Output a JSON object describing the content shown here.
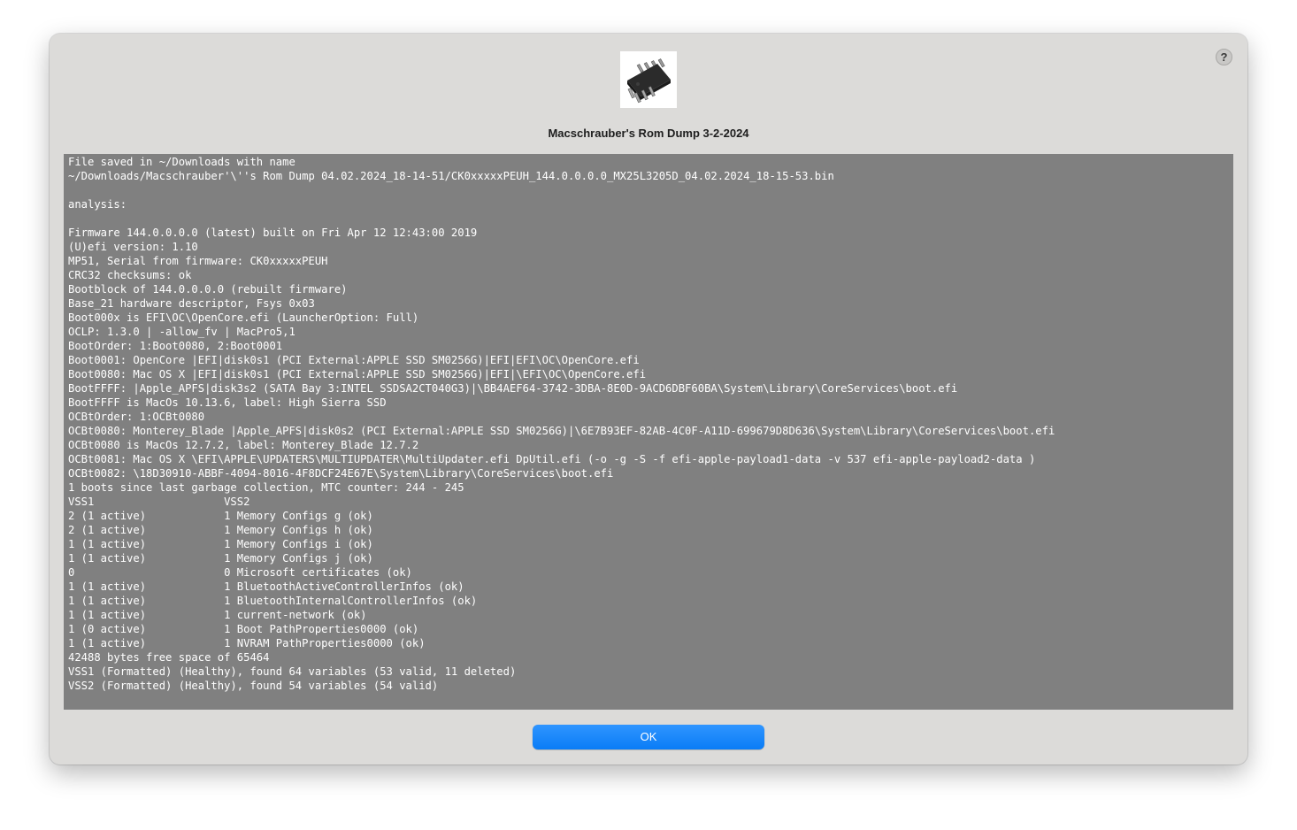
{
  "dialog": {
    "title": "Macschrauber's Rom Dump 3-2-2024",
    "help_label": "?",
    "ok_label": "OK",
    "icon": "chip-icon",
    "log_background": "#808080",
    "accent": "#0a7cf6"
  },
  "log": {
    "lines": [
      "File saved in ~/Downloads with name",
      "~/Downloads/Macschrauber'\\''s Rom Dump 04.02.2024_18-14-51/CK0xxxxxPEUH_144.0.0.0.0_MX25L3205D_04.02.2024_18-15-53.bin",
      "",
      "analysis:",
      "",
      "Firmware 144.0.0.0.0 (latest) built on Fri Apr 12 12:43:00 2019",
      "(U)efi version: 1.10",
      "MP51, Serial from firmware: CK0xxxxxPEUH",
      "CRC32 checksums: ok",
      "Bootblock of 144.0.0.0.0 (rebuilt firmware)",
      "Base_21 hardware descriptor, Fsys 0x03",
      "Boot000x is EFI\\OC\\OpenCore.efi (LauncherOption: Full)",
      "OCLP: 1.3.0 | -allow_fv | MacPro5,1",
      "BootOrder: 1:Boot0080, 2:Boot0001",
      "Boot0001: OpenCore |EFI|disk0s1 (PCI External:APPLE SSD SM0256G)|EFI|EFI\\OC\\OpenCore.efi",
      "Boot0080: Mac OS X |EFI|disk0s1 (PCI External:APPLE SSD SM0256G)|EFI|\\EFI\\OC\\OpenCore.efi",
      "BootFFFF: |Apple_APFS|disk3s2 (SATA Bay 3:INTEL SSDSA2CT040G3)|\\BB4AEF64-3742-3DBA-8E0D-9ACD6DBF60BA\\System\\Library\\CoreServices\\boot.efi",
      "BootFFFF is MacOs 10.13.6, label: High Sierra SSD",
      "OCBtOrder: 1:OCBt0080",
      "OCBt0080: Monterey_Blade |Apple_APFS|disk0s2 (PCI External:APPLE SSD SM0256G)|\\6E7B93EF-82AB-4C0F-A11D-699679D8D636\\System\\Library\\CoreServices\\boot.efi",
      "OCBt0080 is MacOs 12.7.2, label: Monterey_Blade 12.7.2",
      "OCBt0081: Mac OS X \\EFI\\APPLE\\UPDATERS\\MULTIUPDATER\\MultiUpdater.efi DpUtil.efi (-o -g -S -f efi-apple-payload1-data -v 537 efi-apple-payload2-data )",
      "OCBt0082: \\18D30910-ABBF-4094-8016-4F8DCF24E67E\\System\\Library\\CoreServices\\boot.efi",
      "1 boots since last garbage collection, MTC counter: 244 - 245",
      "VSS1                    VSS2",
      "2 (1 active)            1 Memory Configs g (ok)",
      "2 (1 active)            1 Memory Configs h (ok)",
      "1 (1 active)            1 Memory Configs i (ok)",
      "1 (1 active)            1 Memory Configs j (ok)",
      "0                       0 Microsoft certificates (ok)",
      "1 (1 active)            1 BluetoothActiveControllerInfos (ok)",
      "1 (1 active)            1 BluetoothInternalControllerInfos (ok)",
      "1 (1 active)            1 current-network (ok)",
      "1 (0 active)            1 Boot PathProperties0000 (ok)",
      "1 (1 active)            1 NVRAM PathProperties0000 (ok)",
      "42488 bytes free space of 65464",
      "VSS1 (Formatted) (Healthy), found 64 variables (53 valid, 11 deleted)",
      "VSS2 (Formatted) (Healthy), found 54 variables (54 valid)"
    ]
  }
}
